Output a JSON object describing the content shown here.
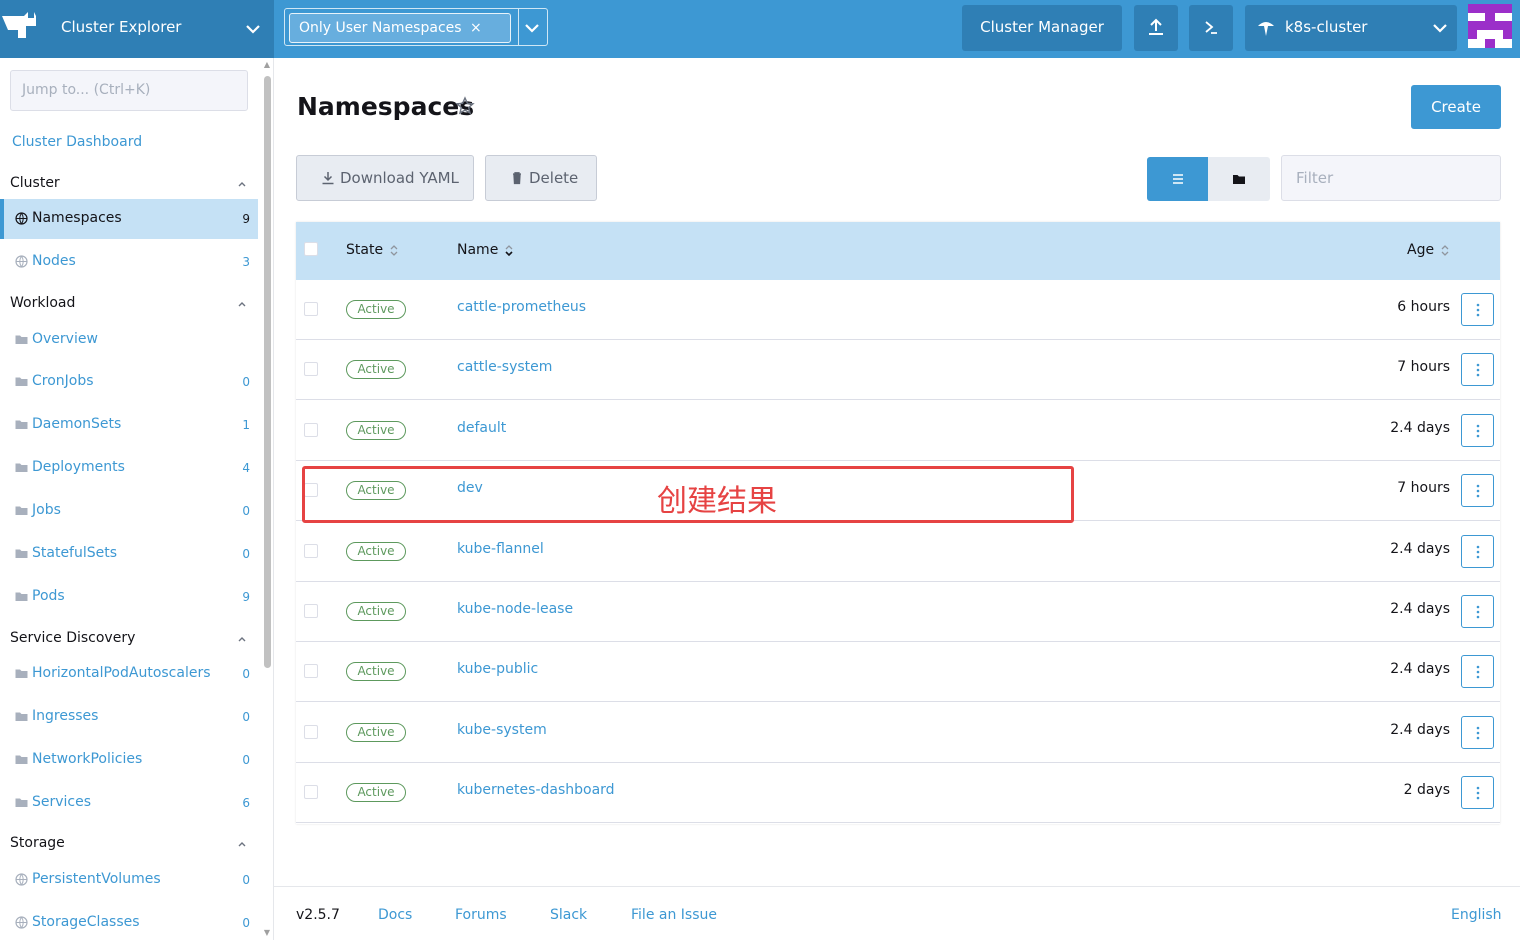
{
  "header": {
    "app_title": "Cluster Explorer",
    "ns_filter_chip": "Only User Namespaces",
    "ns_filter_remove": "×",
    "cluster_manager_label": "Cluster Manager",
    "cluster_name": "k8s-cluster"
  },
  "sidebar": {
    "jump_placeholder": "Jump to... (Ctrl+K)",
    "dashboard_link": "Cluster Dashboard",
    "groups": [
      {
        "label": "Cluster",
        "items": [
          {
            "label": "Namespaces",
            "count": "9",
            "icon": "globe-icon",
            "active": true
          },
          {
            "label": "Nodes",
            "count": "3",
            "icon": "globe-icon"
          }
        ]
      },
      {
        "label": "Workload",
        "items": [
          {
            "label": "Overview",
            "count": "",
            "icon": "folder-icon"
          },
          {
            "label": "CronJobs",
            "count": "0",
            "icon": "folder-icon"
          },
          {
            "label": "DaemonSets",
            "count": "1",
            "icon": "folder-icon"
          },
          {
            "label": "Deployments",
            "count": "4",
            "icon": "folder-icon"
          },
          {
            "label": "Jobs",
            "count": "0",
            "icon": "folder-icon"
          },
          {
            "label": "StatefulSets",
            "count": "0",
            "icon": "folder-icon"
          },
          {
            "label": "Pods",
            "count": "9",
            "icon": "folder-icon"
          }
        ]
      },
      {
        "label": "Service Discovery",
        "items": [
          {
            "label": "HorizontalPodAutoscalers",
            "count": "0",
            "icon": "folder-icon"
          },
          {
            "label": "Ingresses",
            "count": "0",
            "icon": "folder-icon"
          },
          {
            "label": "NetworkPolicies",
            "count": "0",
            "icon": "folder-icon"
          },
          {
            "label": "Services",
            "count": "6",
            "icon": "folder-icon"
          }
        ]
      },
      {
        "label": "Storage",
        "items": [
          {
            "label": "PersistentVolumes",
            "count": "0",
            "icon": "globe-icon"
          },
          {
            "label": "StorageClasses",
            "count": "0",
            "icon": "globe-icon"
          }
        ]
      }
    ]
  },
  "main": {
    "title": "Namespaces",
    "create_label": "Create",
    "download_label": "Download YAML",
    "delete_label": "Delete",
    "filter_placeholder": "Filter",
    "columns": {
      "state": "State",
      "name": "Name",
      "age": "Age"
    },
    "rows": [
      {
        "state": "Active",
        "name": "cattle-prometheus",
        "age": "6 hours"
      },
      {
        "state": "Active",
        "name": "cattle-system",
        "age": "7 hours"
      },
      {
        "state": "Active",
        "name": "default",
        "age": "2.4 days"
      },
      {
        "state": "Active",
        "name": "dev",
        "age": "7 hours"
      },
      {
        "state": "Active",
        "name": "kube-flannel",
        "age": "2.4 days"
      },
      {
        "state": "Active",
        "name": "kube-node-lease",
        "age": "2.4 days"
      },
      {
        "state": "Active",
        "name": "kube-public",
        "age": "2.4 days"
      },
      {
        "state": "Active",
        "name": "kube-system",
        "age": "2.4 days"
      },
      {
        "state": "Active",
        "name": "kubernetes-dashboard",
        "age": "2 days"
      }
    ],
    "annotation": "创建结果"
  },
  "footer": {
    "version": "v2.5.7",
    "links": [
      "Docs",
      "Forums",
      "Slack",
      "File an Issue"
    ],
    "language": "English"
  },
  "colors": {
    "primary": "#3d98d3",
    "header_dark": "#2f7fb5",
    "active_row": "#c5e1f5",
    "status_green": "#5d995d",
    "annotation_red": "#e64343"
  }
}
